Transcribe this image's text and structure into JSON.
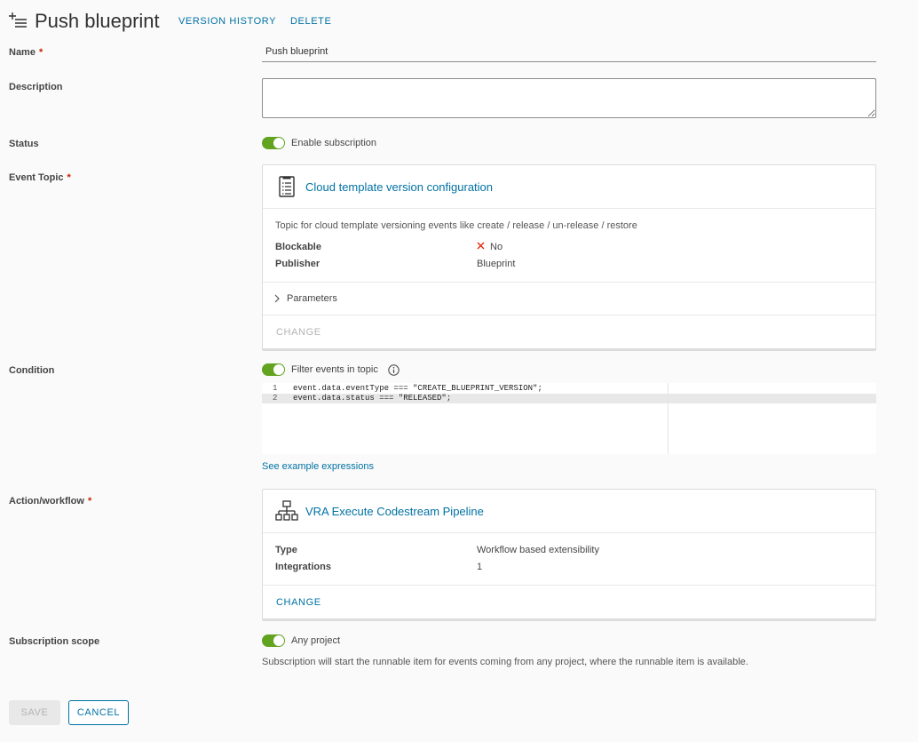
{
  "header": {
    "title": "Push blueprint",
    "version_history_label": "VERSION HISTORY",
    "delete_label": "DELETE"
  },
  "form": {
    "name": {
      "label": "Name",
      "required": "*",
      "value": "Push blueprint"
    },
    "description": {
      "label": "Description",
      "value": ""
    },
    "status": {
      "label": "Status",
      "toggle_label": "Enable subscription",
      "enabled": true
    },
    "event_topic": {
      "label": "Event Topic",
      "required": "*",
      "card": {
        "title": "Cloud template version configuration",
        "description": "Topic for cloud template versioning events like create / release / un-release / restore",
        "blockable_key": "Blockable",
        "blockable_value": "No",
        "publisher_key": "Publisher",
        "publisher_value": "Blueprint",
        "parameters_label": "Parameters",
        "change_label": "CHANGE"
      }
    },
    "condition": {
      "label": "Condition",
      "toggle_label": "Filter events in topic",
      "enabled": true,
      "code_lines": [
        {
          "num": "1",
          "text": "event.data.eventType === \"CREATE_BLUEPRINT_VERSION\";"
        },
        {
          "num": "2",
          "text": "event.data.status === \"RELEASED\";"
        }
      ],
      "example_link": "See example expressions"
    },
    "action": {
      "label": "Action/workflow",
      "required": "*",
      "card": {
        "title": "VRA Execute Codestream Pipeline",
        "type_key": "Type",
        "type_value": "Workflow based extensibility",
        "integrations_key": "Integrations",
        "integrations_value": "1",
        "change_label": "CHANGE"
      }
    },
    "scope": {
      "label": "Subscription scope",
      "toggle_label": "Any project",
      "enabled": true,
      "help": "Subscription will start the runnable item for events coming from any project, where the runnable item is available."
    }
  },
  "footer": {
    "save_label": "SAVE",
    "cancel_label": "CANCEL"
  },
  "colors": {
    "accent": "#0072a3",
    "toggle_on": "#62a420",
    "required": "#c92100",
    "no_cross": "#e12200"
  }
}
